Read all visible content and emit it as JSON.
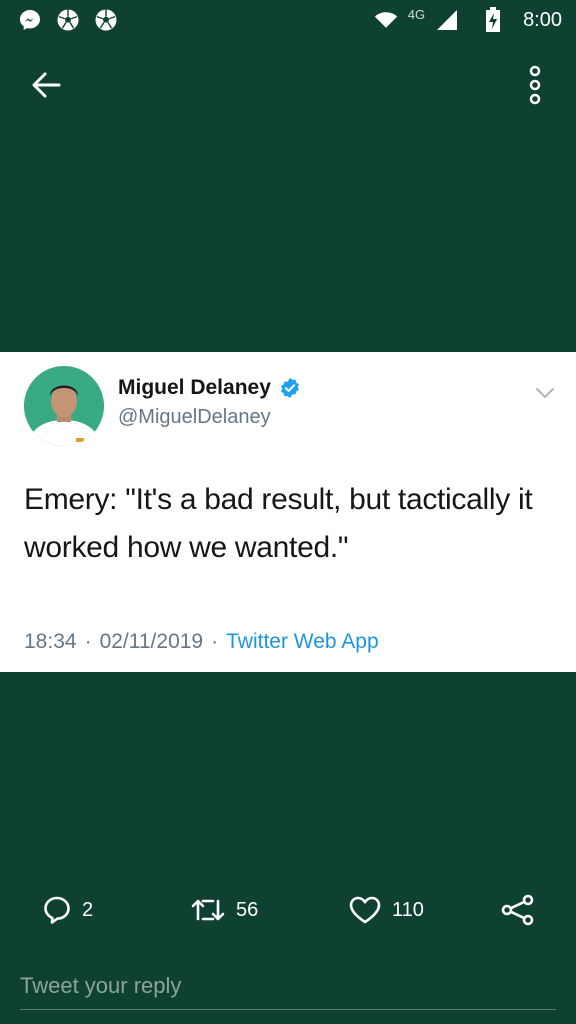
{
  "status_bar": {
    "network": "4G",
    "time": "8:00",
    "icons": [
      "messenger-icon",
      "soccer-ball-icon",
      "soccer-ball-icon",
      "wifi-icon",
      "cell-signal-icon",
      "battery-charging-icon"
    ]
  },
  "toolbar": {
    "back_icon": "arrow-left-icon",
    "more_icon": "more-vertical-icon"
  },
  "tweet": {
    "display_name": "Miguel Delaney",
    "handle": "@MiguelDelaney",
    "verified": true,
    "text": "Emery: \"It's a bad result, but tactically it worked how we wanted.\"",
    "time": "18:34",
    "separator": "·",
    "date": "02/11/2019",
    "source": "Twitter Web App"
  },
  "actions": {
    "reply_count": "2",
    "retweet_count": "56",
    "like_count": "110"
  },
  "reply": {
    "placeholder": "Tweet your reply"
  },
  "colors": {
    "background": "#0f4133",
    "card": "#ffffff",
    "verified": "#1da1f2",
    "link": "#1b95e0",
    "muted": "#657786"
  }
}
